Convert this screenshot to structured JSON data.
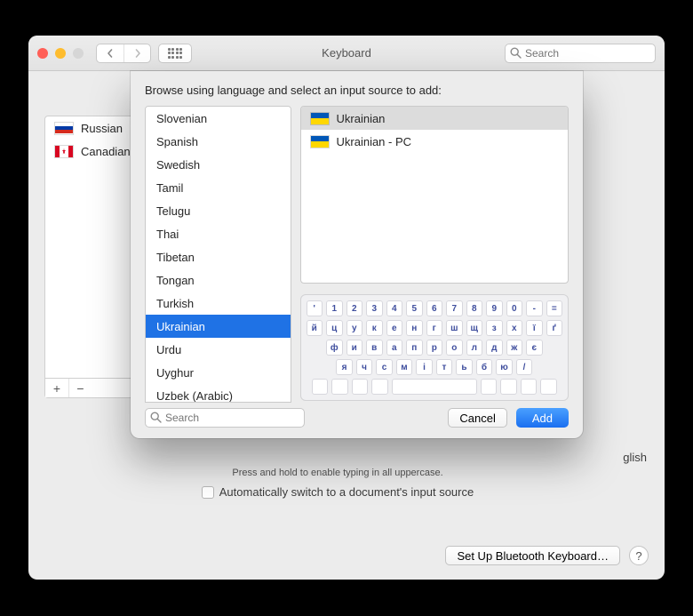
{
  "window": {
    "title": "Keyboard",
    "search_placeholder": "Search"
  },
  "background": {
    "existing_sources": [
      {
        "flag": "ru",
        "name": "Russian"
      },
      {
        "flag": "ca",
        "name": "Canadian English"
      }
    ],
    "partial_label_right": "glish",
    "hint_line": "Press and hold to enable typing in all uppercase.",
    "auto_switch_label": "Automatically switch to a document's input source",
    "bluetooth_btn": "Set Up Bluetooth Keyboard…"
  },
  "sheet": {
    "header": "Browse using language and select an input source to add:",
    "languages": [
      "Slovenian",
      "Spanish",
      "Swedish",
      "Tamil",
      "Telugu",
      "Thai",
      "Tibetan",
      "Tongan",
      "Turkish",
      "Ukrainian",
      "Urdu",
      "Uyghur",
      "Uzbek (Arabic)"
    ],
    "selected_language_index": 9,
    "input_sources": [
      {
        "name": "Ukrainian",
        "selected": true
      },
      {
        "name": "Ukrainian - PC",
        "selected": false
      }
    ],
    "keyboard_rows": [
      [
        "'",
        "1",
        "2",
        "3",
        "4",
        "5",
        "6",
        "7",
        "8",
        "9",
        "0",
        "-",
        "="
      ],
      [
        "й",
        "ц",
        "у",
        "к",
        "е",
        "н",
        "г",
        "ш",
        "щ",
        "з",
        "х",
        "ї",
        "ґ"
      ],
      [
        "ф",
        "и",
        "в",
        "а",
        "п",
        "р",
        "о",
        "л",
        "д",
        "ж",
        "є"
      ],
      [
        "я",
        "ч",
        "с",
        "м",
        "і",
        "т",
        "ь",
        "б",
        "ю",
        "/"
      ]
    ],
    "search_placeholder": "Search",
    "cancel": "Cancel",
    "add": "Add"
  }
}
